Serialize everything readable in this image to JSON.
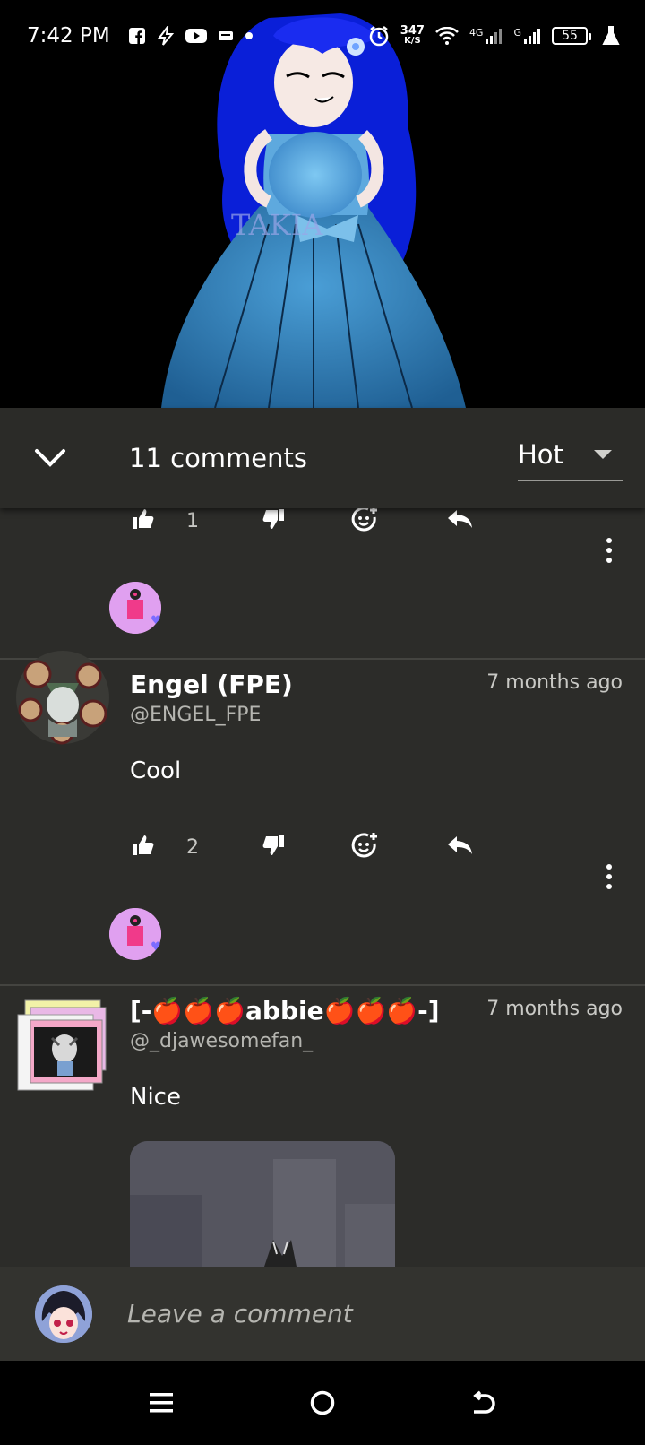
{
  "status_bar": {
    "time": "7:42 PM",
    "speed_value": "347",
    "speed_unit": "K/S",
    "net_4g": "4G",
    "net_g": "G",
    "battery": "55",
    "icons": [
      "facebook-icon",
      "flash-icon",
      "youtube-icon",
      "message-icon",
      "dot-icon",
      "alarm-icon",
      "wifi-icon",
      "signal-icon",
      "lab-icon"
    ]
  },
  "artwork": {
    "watermark": "TAKIA"
  },
  "comments_header": {
    "count_label": "11 comments",
    "sort_value": "Hot"
  },
  "comments": [
    {
      "likes": "1"
    },
    {
      "author": "Engel (FPE)",
      "handle": "@ENGEL_FPE",
      "time": "7 months ago",
      "text": "Cool",
      "likes": "2"
    },
    {
      "author": "[-🍎🍎🍎abbie🍎🍎🍎-]",
      "handle": "@_djawesomefan_",
      "time": "7 months ago",
      "text": "Nice"
    }
  ],
  "composer": {
    "placeholder": "Leave a comment"
  },
  "colors": {
    "panel": "#2c2c29",
    "header": "#2b2b28",
    "composer": "#33332f",
    "heart": "#7c6cff"
  }
}
